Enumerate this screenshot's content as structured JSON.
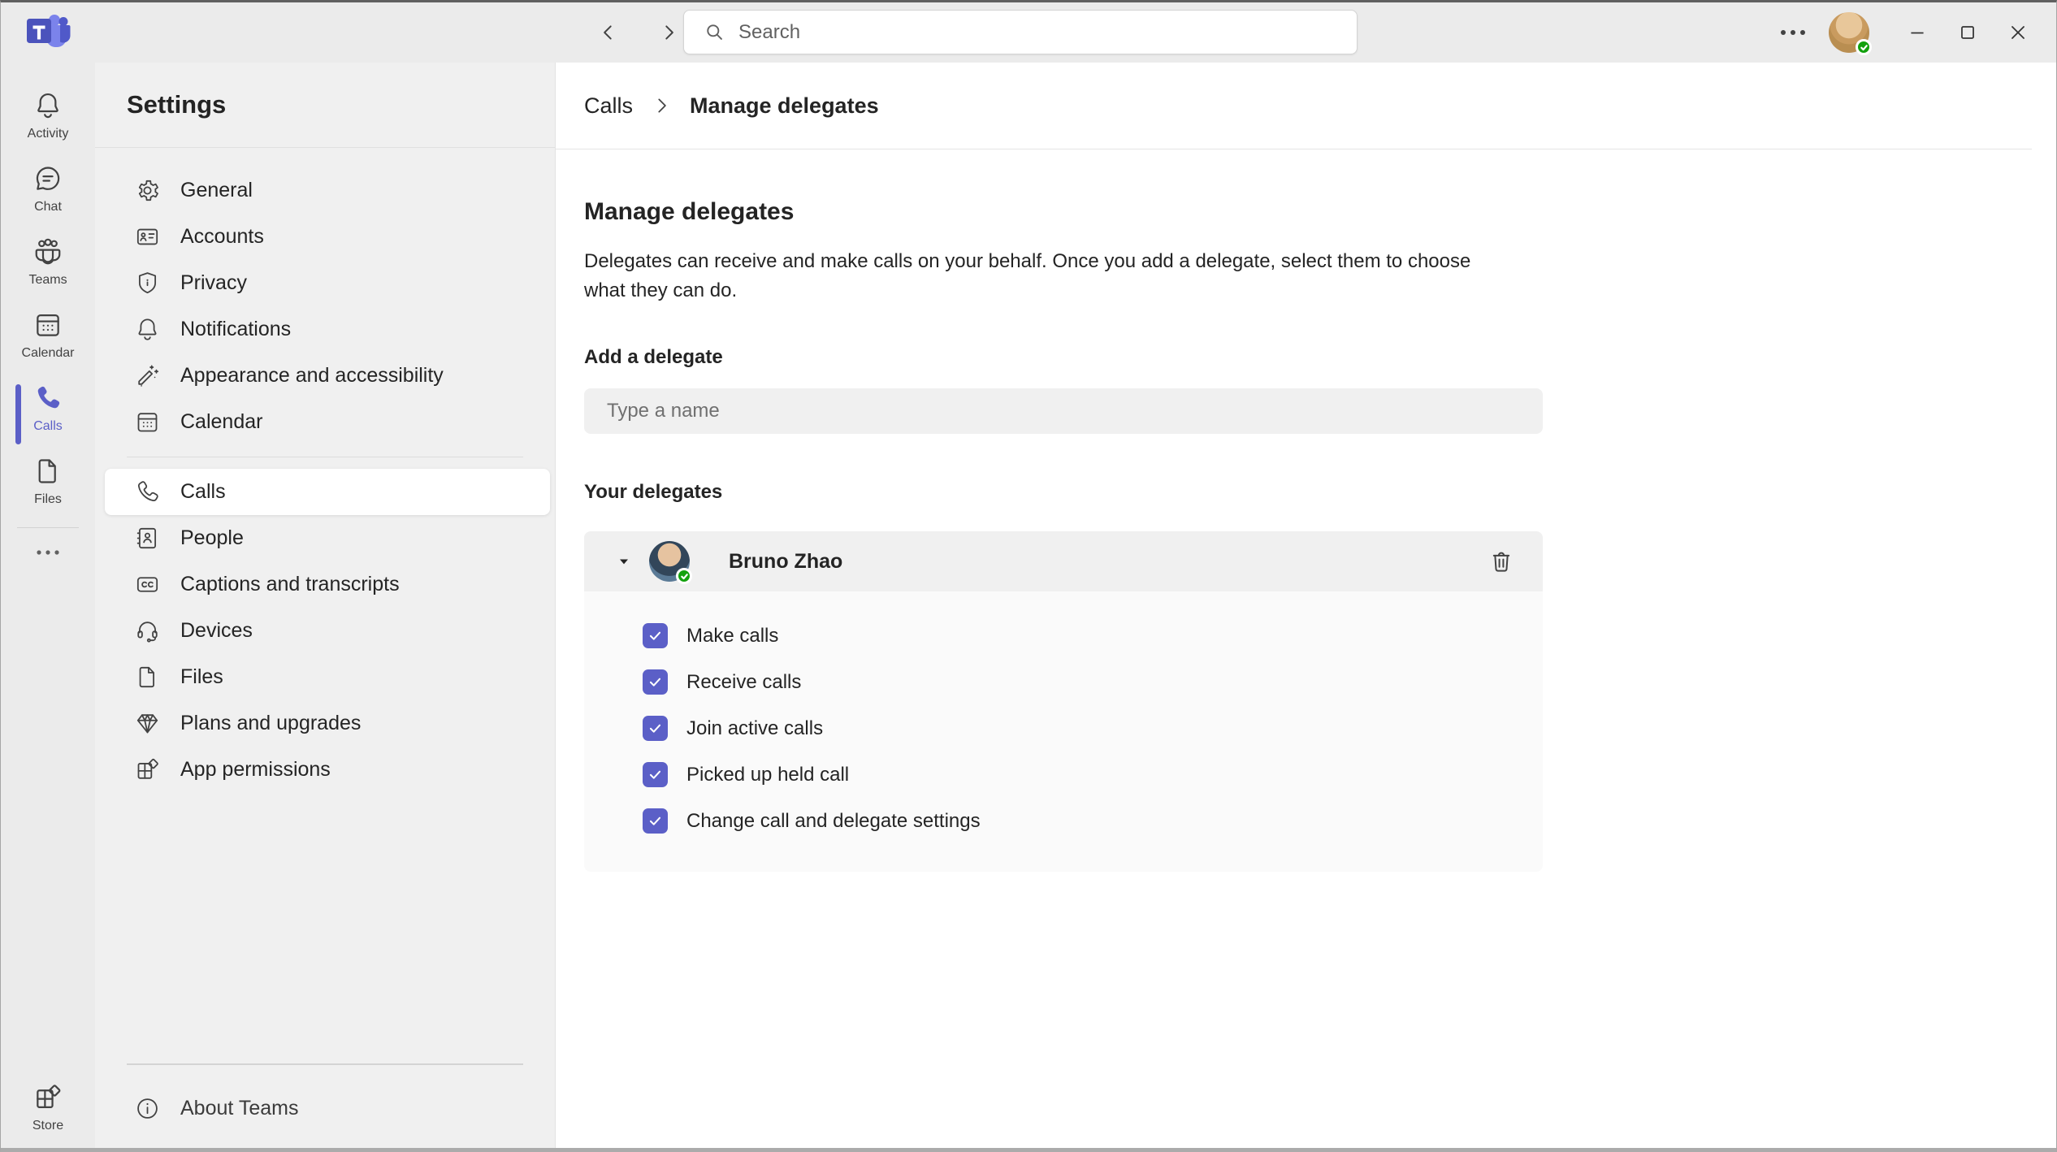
{
  "colors": {
    "accent": "#5b5fc7",
    "presence_green": "#13a10e",
    "topbar_bg": "#ebebeb",
    "sidebar_bg": "#f0f0f0",
    "main_bg": "#ffffff"
  },
  "topbar": {
    "search_placeholder": "Search",
    "icons": [
      "teams-logo",
      "back-arrow-icon",
      "forward-arrow-icon",
      "search-icon",
      "more-icon",
      "avatar-presence-check",
      "minimize-icon",
      "maximize-icon",
      "close-icon"
    ]
  },
  "rail": {
    "items": [
      {
        "label": "Activity",
        "icon": "bell-icon",
        "selected": false
      },
      {
        "label": "Chat",
        "icon": "chat-icon",
        "selected": false
      },
      {
        "label": "Teams",
        "icon": "teams-people-icon",
        "selected": false
      },
      {
        "label": "Calendar",
        "icon": "calendar-icon",
        "selected": false
      },
      {
        "label": "Calls",
        "icon": "phone-icon",
        "selected": true
      },
      {
        "label": "Files",
        "icon": "file-icon",
        "selected": false
      },
      {
        "label": "Store",
        "icon": "store-icon",
        "selected": false
      }
    ],
    "more_icon": "more-icon"
  },
  "sidebar": {
    "title": "Settings",
    "items": [
      {
        "label": "General",
        "icon": "gear-icon"
      },
      {
        "label": "Accounts",
        "icon": "id-card-icon"
      },
      {
        "label": "Privacy",
        "icon": "shield-icon"
      },
      {
        "label": "Notifications",
        "icon": "bell-icon"
      },
      {
        "label": "Appearance and accessibility",
        "icon": "wand-icon"
      },
      {
        "label": "Calendar",
        "icon": "calendar-icon"
      },
      {
        "label": "Calls",
        "icon": "phone-outline-icon",
        "selected": true
      },
      {
        "label": "People",
        "icon": "contact-book-icon"
      },
      {
        "label": "Captions and transcripts",
        "icon": "cc-icon"
      },
      {
        "label": "Devices",
        "icon": "headset-icon"
      },
      {
        "label": "Files",
        "icon": "file-icon"
      },
      {
        "label": "Plans and upgrades",
        "icon": "diamond-icon"
      },
      {
        "label": "App permissions",
        "icon": "app-grid-icon"
      }
    ],
    "about_label": "About Teams",
    "about_icon": "info-icon"
  },
  "main": {
    "breadcrumb": {
      "parent": "Calls",
      "current": "Manage delegates"
    },
    "heading": "Manage delegates",
    "description": "Delegates can receive and make calls on your behalf. Once you add a delegate, select them to choose what they can do.",
    "add_delegate_label": "Add a delegate",
    "input_placeholder": "Type a name",
    "your_delegates_label": "Your delegates",
    "delegate": {
      "name": "Bruno Zhao",
      "status": "available",
      "expanded": true,
      "permissions": [
        {
          "label": "Make calls",
          "checked": true
        },
        {
          "label": "Receive calls",
          "checked": true
        },
        {
          "label": "Join active calls",
          "checked": true
        },
        {
          "label": "Picked up held call",
          "checked": true
        },
        {
          "label": "Change call and delegate settings",
          "checked": true
        }
      ]
    }
  }
}
